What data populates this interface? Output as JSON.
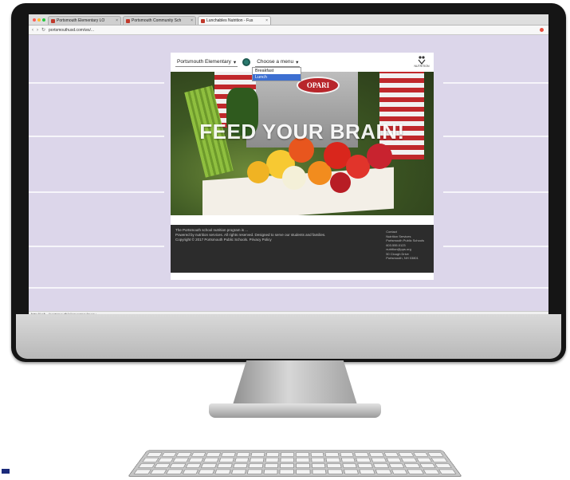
{
  "browser": {
    "tabs": [
      {
        "label": "Portsmouth Elementary LO",
        "active": false
      },
      {
        "label": "Portsmouth Community Sch",
        "active": false
      },
      {
        "label": "Lunchables Nutrition - Fus",
        "active": true
      }
    ],
    "url": "portsmouthusd.com/ws/...",
    "status_text": "http://sch.../portsmouth/elementary/menu"
  },
  "site": {
    "school_select": "Portsmouth Elementary",
    "menu_select": "Choose a menu",
    "menu_options": [
      "Breakfast",
      "Lunch"
    ],
    "logo_text": "NUTRITION",
    "badge_text": "OPARI",
    "hero_title": "FEED YOUR BRAIN!",
    "footer": {
      "lines": [
        "The Portsmouth school nutrition program is ...",
        "Powered by nutrition services. All rights reserved. Designed to serve our students and families.",
        "Copyright © 2017 Portsmouth Public Schools. Privacy Policy"
      ],
      "contact": [
        "Contact",
        "Nutrition Services",
        "Portsmouth Public Schools",
        "603.555.0123",
        "nutrition@pps.org",
        "50 Clough Drive",
        "Portsmouth, NH 03801"
      ]
    }
  },
  "colors": {
    "page_bg": "#dcd6ea",
    "go_button": "#2a7a6e",
    "footer_bg": "#2c2c2c",
    "badge": "#b8262b",
    "selected_option": "#3d6fd1"
  }
}
